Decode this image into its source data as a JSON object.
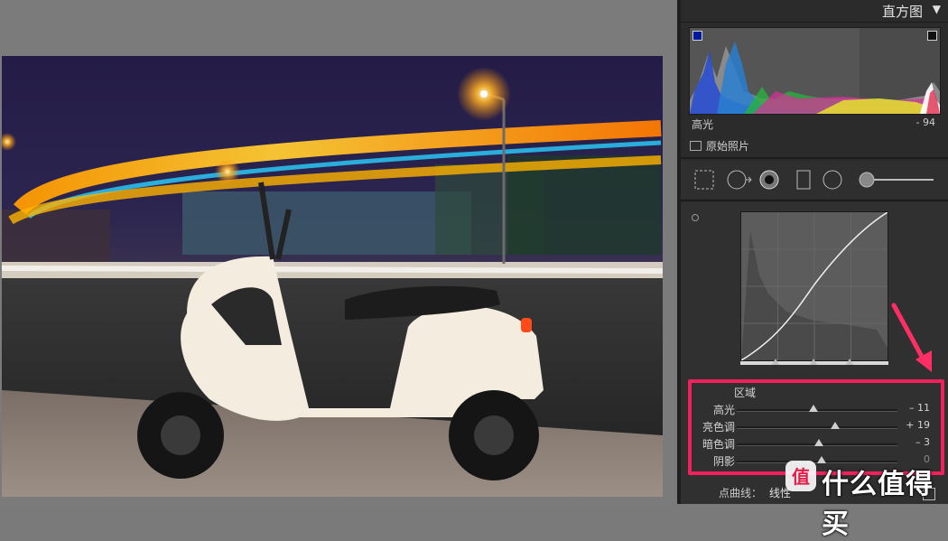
{
  "app": {
    "panel_title": "直方图",
    "panel_collapse_glyph": "▼"
  },
  "histogram": {
    "channel_label": "高光",
    "channel_value": "- 94",
    "original_photo_label": "原始照片"
  },
  "tone_curve": {
    "region_title": "区域",
    "sliders": [
      {
        "label": "高光",
        "value_text": "– 11",
        "value": -11
      },
      {
        "label": "亮色调",
        "value_text": "+ 19",
        "value": 19
      },
      {
        "label": "暗色调",
        "value_text": "– 3",
        "value": -3
      },
      {
        "label": "阴影",
        "value_text": "0",
        "value": 0
      }
    ],
    "point_curve_label": "点曲线：",
    "point_curve_value": "线性"
  },
  "watermark": {
    "text": "什么值得买"
  },
  "colors": {
    "highlight": "#f0215b",
    "panel_bg": "#2b2b2b",
    "arrow": "#ff2e63"
  }
}
